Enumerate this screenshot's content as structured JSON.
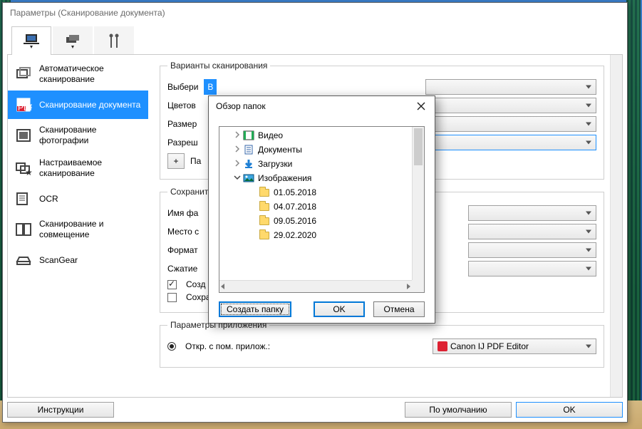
{
  "window": {
    "title": "Параметры (Сканирование документа)"
  },
  "sidebar": {
    "items": [
      {
        "label": "Автоматическое\nсканирование"
      },
      {
        "label": "Сканирование документа"
      },
      {
        "label": "Сканирование фотографии"
      },
      {
        "label": "Настраиваемое сканирование"
      },
      {
        "label": "OCR"
      },
      {
        "label": "Сканирование и совмещение"
      },
      {
        "label": "ScanGear"
      }
    ]
  },
  "scan_options": {
    "legend": "Варианты сканирования",
    "select_source": "Выбери",
    "color_mode": "Цветов",
    "size": "Размер",
    "resolution": "Разреш",
    "params_short": "Па",
    "button_label": "В"
  },
  "save_options": {
    "legend": "Сохранит",
    "filename": "Имя фа",
    "location": "Место с",
    "format": "Формат",
    "compress": "Сжатие",
    "make_subfolder": "Созд",
    "save_date_subfolder": "Сохранение в подпапку с текущей датой"
  },
  "app_options": {
    "legend": "Параметры приложения",
    "open_with_label": "Откр. с пом. прилож.:",
    "app_value": "Canon IJ PDF Editor"
  },
  "footer": {
    "instructions": "Инструкции",
    "defaults": "По умолчанию",
    "ok": "OK"
  },
  "dialog": {
    "title": "Обзор папок",
    "tree": [
      {
        "indent": 0,
        "expander": ">",
        "icon": "video",
        "label": "Видео"
      },
      {
        "indent": 0,
        "expander": ">",
        "icon": "doc",
        "label": "Документы"
      },
      {
        "indent": 0,
        "expander": ">",
        "icon": "down",
        "label": "Загрузки"
      },
      {
        "indent": 0,
        "expander": "v",
        "icon": "img",
        "label": "Изображения"
      },
      {
        "indent": 1,
        "expander": "",
        "icon": "folder",
        "label": "01.05.2018"
      },
      {
        "indent": 1,
        "expander": "",
        "icon": "folder",
        "label": "04.07.2018"
      },
      {
        "indent": 1,
        "expander": "",
        "icon": "folder",
        "label": "09.05.2016"
      },
      {
        "indent": 1,
        "expander": "",
        "icon": "folder",
        "label": "29.02.2020"
      }
    ],
    "create_folder": "Создать папку",
    "ok": "OK",
    "cancel": "Отмена"
  }
}
